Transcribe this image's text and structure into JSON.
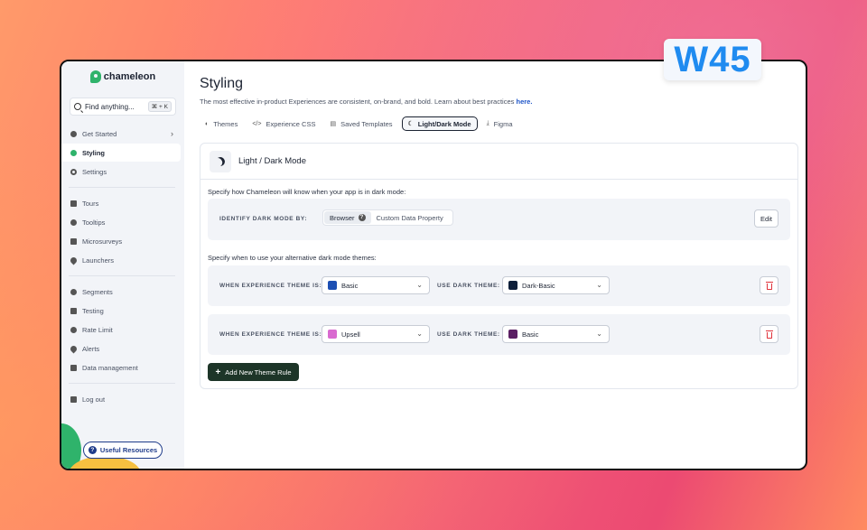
{
  "badge": "W45",
  "brand": {
    "name": "chameleon"
  },
  "search": {
    "placeholder": "Find anything...",
    "shortcut": "⌘ + K"
  },
  "sidebar": {
    "groups": [
      [
        {
          "label": "Get Started",
          "icon": "play-circle-icon",
          "chevron": "›"
        },
        {
          "label": "Styling",
          "icon": "palette-icon",
          "active": true
        },
        {
          "label": "Settings",
          "icon": "gear-icon"
        }
      ],
      [
        {
          "label": "Tours",
          "icon": "tours-icon"
        },
        {
          "label": "Tooltips",
          "icon": "tooltip-icon"
        },
        {
          "label": "Microsurveys",
          "icon": "star-icon"
        },
        {
          "label": "Launchers",
          "icon": "launcher-icon"
        }
      ],
      [
        {
          "label": "Segments",
          "icon": "users-icon"
        },
        {
          "label": "Testing",
          "icon": "flask-icon"
        },
        {
          "label": "Rate Limit",
          "icon": "clock-icon"
        },
        {
          "label": "Alerts",
          "icon": "bell-icon"
        },
        {
          "label": "Data management",
          "icon": "database-icon"
        }
      ],
      [
        {
          "label": "Log out",
          "icon": "logout-icon"
        }
      ]
    ],
    "resources_label": "Useful Resources"
  },
  "header": {
    "title": "Styling",
    "subtitle": "The most effective in-product Experiences are consistent, on-brand, and bold. Learn about best practices",
    "link": "here."
  },
  "tabs": [
    {
      "label": "Themes",
      "icon": "palette-icon",
      "glyph": "◐"
    },
    {
      "label": "Experience CSS",
      "icon": "code-icon",
      "glyph": "</>"
    },
    {
      "label": "Saved Templates",
      "icon": "templates-icon",
      "glyph": "▤"
    },
    {
      "label": "Light/Dark Mode",
      "icon": "moon-icon",
      "glyph": "☾",
      "active": true
    },
    {
      "label": "Figma",
      "icon": "download-icon",
      "glyph": "⤓"
    }
  ],
  "card": {
    "title": "Light / Dark Mode",
    "detect_intro": "Specify how Chameleon will know when your app is in dark mode:",
    "identify_label": "IDENTIFY DARK MODE BY:",
    "options": [
      "Browser",
      "Custom Data Property"
    ],
    "selected_option": "Browser",
    "edit_label": "Edit",
    "rules_intro": "Specify when to use your alternative dark mode themes:",
    "when_label": "WHEN EXPERIENCE THEME IS:",
    "use_label": "USE DARK THEME:",
    "rules": [
      {
        "theme": {
          "name": "Basic",
          "color": "#1c4fb3"
        },
        "dark": {
          "name": "Dark-Basic",
          "color": "#0e1f3a"
        }
      },
      {
        "theme": {
          "name": "Upsell",
          "color": "#d96ad0"
        },
        "dark": {
          "name": "Basic",
          "color": "#5a1f63"
        }
      }
    ],
    "add_label": "Add New Theme Rule"
  }
}
